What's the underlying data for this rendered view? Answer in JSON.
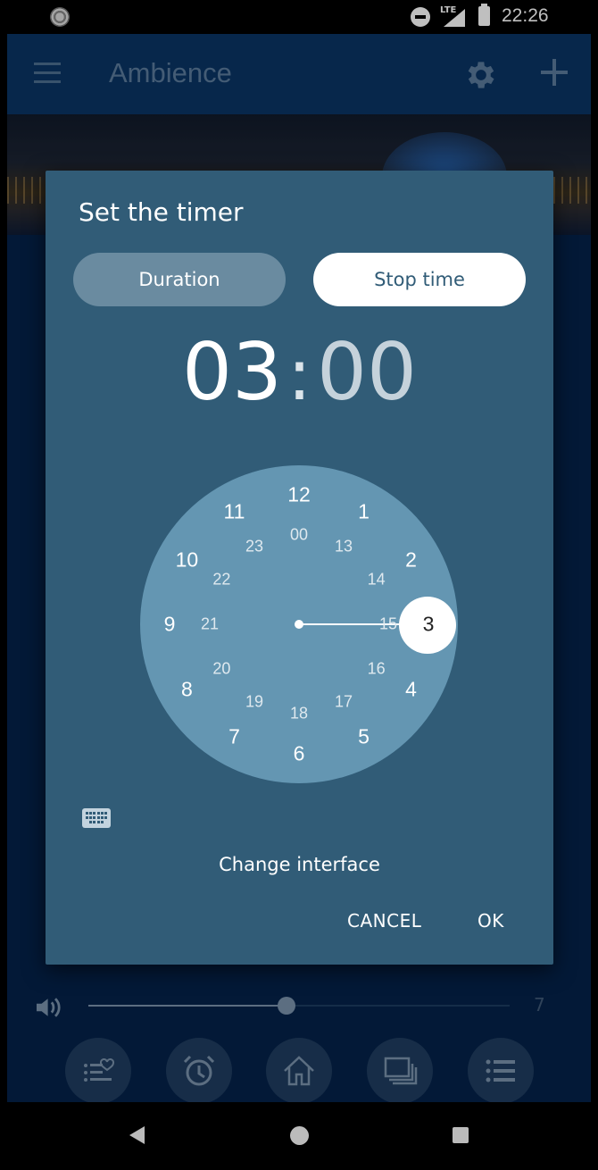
{
  "status_bar": {
    "time": "22:26",
    "network": "LTE"
  },
  "app": {
    "title": "Ambience"
  },
  "volume": {
    "level": 7,
    "fraction": 0.47
  },
  "dialog": {
    "title": "Set the timer",
    "mode_duration_label": "Duration",
    "mode_stoptime_label": "Stop time",
    "time_hour": "03",
    "time_separator": ":",
    "time_minute": "00",
    "clock_outer": [
      "12",
      "1",
      "2",
      "3",
      "4",
      "5",
      "6",
      "7",
      "8",
      "9",
      "10",
      "11"
    ],
    "clock_inner": [
      "00",
      "13",
      "14",
      "15",
      "16",
      "17",
      "18",
      "19",
      "20",
      "21",
      "22",
      "23"
    ],
    "selected_hour": "3",
    "change_interface_label": "Change interface",
    "cancel_label": "CANCEL",
    "ok_label": "OK"
  },
  "colors": {
    "dialog_bg": "#315c77",
    "clock_face": "#6496b2",
    "toolbar": "#0a3565",
    "app_bg": "#05224a"
  },
  "icons": [
    "menu-icon",
    "gear-icon",
    "plus-icon",
    "speaker-icon",
    "favorites-list-icon",
    "alarm-clock-icon",
    "home-icon",
    "layers-icon",
    "list-icon",
    "keyboard-icon"
  ]
}
